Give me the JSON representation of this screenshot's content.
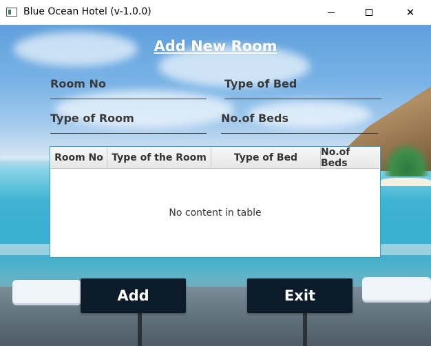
{
  "window": {
    "title": "Blue Ocean Hotel (v-1.0.0)",
    "minimize_icon": "minimize-icon",
    "maximize_icon": "maximize-icon",
    "close_icon": "close-icon"
  },
  "form": {
    "title": "Add New Room",
    "fields": {
      "room_no": {
        "label": "Room No",
        "value": ""
      },
      "type_of_bed": {
        "label": "Type of Bed",
        "value": ""
      },
      "type_of_room": {
        "label": "Type of Room",
        "value": ""
      },
      "no_of_beds": {
        "label": "No.of Beds",
        "value": ""
      }
    }
  },
  "table": {
    "columns": [
      "Room No",
      "Type of the Room",
      "Type of Bed",
      "No.of Beds"
    ],
    "rows": [],
    "empty_message": "No content in table"
  },
  "buttons": {
    "add": "Add",
    "exit": "Exit"
  },
  "colors": {
    "button_bg": "#0b1b2a",
    "table_border": "#2aa3c9",
    "label_text": "#3a3a3a"
  }
}
